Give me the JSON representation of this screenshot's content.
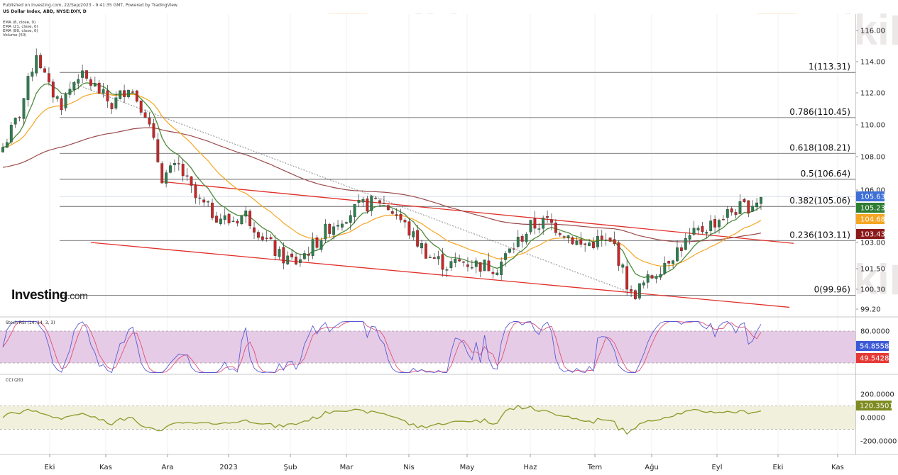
{
  "header": {
    "published": "Published on Investing.com, 22/Sep/2023 - 9:41:35 GMT, Powered by TradingView.",
    "symbol": "US Dollar Index, ABD, NYSE:DXY, D",
    "indicators": [
      "EMA (8, close, 0)",
      "EMA (21, close, 0)",
      "EMA (89, close, 0)",
      "Volume (50)"
    ]
  },
  "logo": {
    "name": "Investing",
    "suffix": ".com"
  },
  "watermark": "WikiFX",
  "colors": {
    "up": "#2e7d4f",
    "down": "#c62828",
    "ema8": "#4e8a3c",
    "ema21": "#f5a623",
    "ema89": "#9b4a4a",
    "channel": "#e0302a",
    "fib": "#555555",
    "rsi_k": "#5b5bd6",
    "rsi_d": "#e0507a",
    "rsi_band": "#e6cbe6",
    "cci": "#8b9a2a",
    "cci_band": "#f1f0dc"
  },
  "chart_data": [
    {
      "type": "candlestick",
      "title": "US Dollar Index, ABD, NYSE:DXY, D",
      "x_tick_labels": [
        "Eki",
        "Kas",
        "Ara",
        "2023",
        "Şub",
        "Mar",
        "Nis",
        "May",
        "Haz",
        "Tem",
        "Ağu",
        "Eyl",
        "Eki",
        "Kas"
      ],
      "y_tick_labels": [
        "116.00",
        "114.00",
        "112.00",
        "110.00",
        "108.00",
        "106.00",
        "103.00",
        "101.50",
        "100.30",
        "99.20"
      ],
      "y_tick_values": [
        116,
        114,
        112,
        110,
        108,
        106,
        103,
        101.5,
        100.3,
        99.2
      ],
      "ylim": [
        98.9,
        116.9
      ],
      "close_path": [
        {
          "t": 0,
          "v": 108.6
        },
        {
          "t": 4,
          "v": 110.7
        },
        {
          "t": 8,
          "v": 114.6
        },
        {
          "t": 11,
          "v": 112.3
        },
        {
          "t": 14,
          "v": 111.3
        },
        {
          "t": 18,
          "v": 113.2
        },
        {
          "t": 22,
          "v": 112.4
        },
        {
          "t": 26,
          "v": 111.2
        },
        {
          "t": 30,
          "v": 112.5
        },
        {
          "t": 34,
          "v": 110.8
        },
        {
          "t": 38,
          "v": 106.8
        },
        {
          "t": 42,
          "v": 107.4
        },
        {
          "t": 46,
          "v": 105.5
        },
        {
          "t": 50,
          "v": 104.7
        },
        {
          "t": 54,
          "v": 104.2
        },
        {
          "t": 58,
          "v": 104.6
        },
        {
          "t": 62,
          "v": 103.4
        },
        {
          "t": 66,
          "v": 102.2
        },
        {
          "t": 70,
          "v": 101.9
        },
        {
          "t": 74,
          "v": 102.8
        },
        {
          "t": 78,
          "v": 103.9
        },
        {
          "t": 82,
          "v": 104.6
        },
        {
          "t": 86,
          "v": 105.1
        },
        {
          "t": 90,
          "v": 105.4
        },
        {
          "t": 94,
          "v": 104.6
        },
        {
          "t": 98,
          "v": 103.3
        },
        {
          "t": 102,
          "v": 102.2
        },
        {
          "t": 106,
          "v": 101.7
        },
        {
          "t": 110,
          "v": 101.9
        },
        {
          "t": 114,
          "v": 101.7
        },
        {
          "t": 118,
          "v": 101.6
        },
        {
          "t": 122,
          "v": 102.8
        },
        {
          "t": 126,
          "v": 103.9
        },
        {
          "t": 130,
          "v": 104.2
        },
        {
          "t": 134,
          "v": 103.6
        },
        {
          "t": 138,
          "v": 102.8
        },
        {
          "t": 142,
          "v": 103.1
        },
        {
          "t": 146,
          "v": 102.8
        },
        {
          "t": 150,
          "v": 99.9
        },
        {
          "t": 154,
          "v": 100.8
        },
        {
          "t": 158,
          "v": 101.9
        },
        {
          "t": 162,
          "v": 102.8
        },
        {
          "t": 166,
          "v": 103.6
        },
        {
          "t": 170,
          "v": 104.2
        },
        {
          "t": 174,
          "v": 104.8
        },
        {
          "t": 178,
          "v": 105.1
        },
        {
          "t": 181,
          "v": 105.6
        }
      ],
      "fibonacci": [
        {
          "label": "1(113.31)",
          "value": 113.31
        },
        {
          "label": "0.786(110.45)",
          "value": 110.45
        },
        {
          "label": "0.618(108.21)",
          "value": 108.21
        },
        {
          "label": "0.5(106.64)",
          "value": 106.64
        },
        {
          "label": "0.382(105.06)",
          "value": 105.06
        },
        {
          "label": "0.236(103.11)",
          "value": 103.11
        },
        {
          "label": "0(99.96)",
          "value": 99.96
        }
      ],
      "price_tags": [
        {
          "label": "105.63",
          "value": 105.63,
          "color": "#3d6fd6"
        },
        {
          "label": "105.23",
          "value": 105.23,
          "color": "#2e7d32"
        },
        {
          "label": "104.68",
          "value": 104.68,
          "color": "#f5a623"
        },
        {
          "label": "103.43",
          "value": 103.43,
          "color": "#8b1a1a"
        }
      ]
    },
    {
      "type": "line",
      "title": "Stoch RSI (14, 14, 3, 3)",
      "y_tick_labels": [
        "80.0000"
      ],
      "y_tick_values": [
        80
      ],
      "band": [
        20,
        80
      ],
      "ylim": [
        0,
        100
      ],
      "values_tags": [
        {
          "label": "54.8558",
          "value": 54.8558,
          "color": "#3d5ad6"
        },
        {
          "label": "49.5428",
          "value": 49.5428,
          "color": "#e53935"
        }
      ]
    },
    {
      "type": "line",
      "title": "CCI (20)",
      "y_tick_labels": [
        "200.0000",
        "0.0000",
        "-200.0000"
      ],
      "y_tick_values": [
        200,
        0,
        -200
      ],
      "band": [
        -100,
        100
      ],
      "ylim": [
        -310,
        340
      ],
      "values_tags": [
        {
          "label": "120.3501",
          "value": 120.3501,
          "color": "#7d8a1f"
        }
      ]
    }
  ]
}
